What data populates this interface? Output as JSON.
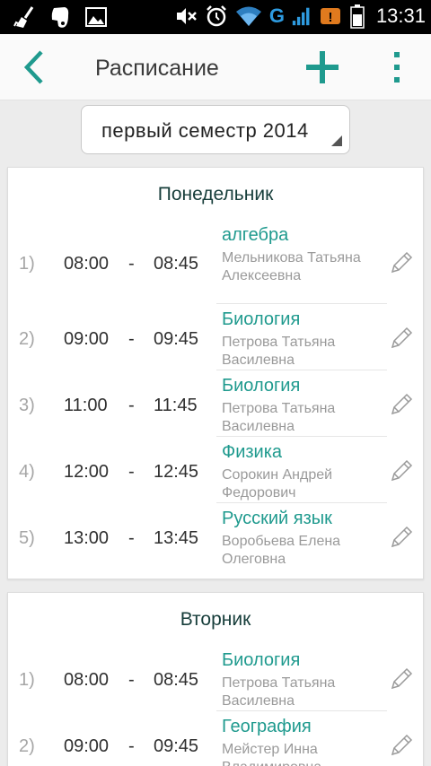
{
  "status_bar": {
    "time": "13:31",
    "left_icons": [
      "broom-icon",
      "evernote-icon",
      "gallery-icon"
    ],
    "right_icons": [
      "mute-icon",
      "alarm-icon",
      "wifi-icon",
      "signal-icon",
      "notification-icon",
      "battery-icon"
    ],
    "network_label": "G"
  },
  "action_bar": {
    "title": "Расписание",
    "accent_color": "#1f9a8e"
  },
  "semester_select": {
    "value": "первый семестр 2014"
  },
  "days": [
    {
      "name": "Понедельник",
      "lessons": [
        {
          "num": "1)",
          "start": "08:00",
          "dash": "-",
          "end": "08:45",
          "subject": "алгебра",
          "teacher": "Мельникова Татьяна Алексеевна"
        },
        {
          "num": "2)",
          "start": "09:00",
          "dash": "-",
          "end": "09:45",
          "subject": "Биология",
          "teacher": "Петрова Татьяна Василевна"
        },
        {
          "num": "3)",
          "start": "11:00",
          "dash": "-",
          "end": "11:45",
          "subject": "Биология",
          "teacher": "Петрова Татьяна Василевна"
        },
        {
          "num": "4)",
          "start": "12:00",
          "dash": "-",
          "end": "12:45",
          "subject": "Физика",
          "teacher": "Сорокин Андрей Федорович"
        },
        {
          "num": "5)",
          "start": "13:00",
          "dash": "-",
          "end": "13:45",
          "subject": "Русский язык",
          "teacher": "Воробьева Елена Олеговна"
        }
      ]
    },
    {
      "name": "Вторник",
      "lessons": [
        {
          "num": "1)",
          "start": "08:00",
          "dash": "-",
          "end": "08:45",
          "subject": "Биология",
          "teacher": "Петрова Татьяна Василевна"
        },
        {
          "num": "2)",
          "start": "09:00",
          "dash": "-",
          "end": "09:45",
          "subject": "География",
          "teacher": "Мейстер Инна Владимировна"
        }
      ]
    }
  ]
}
